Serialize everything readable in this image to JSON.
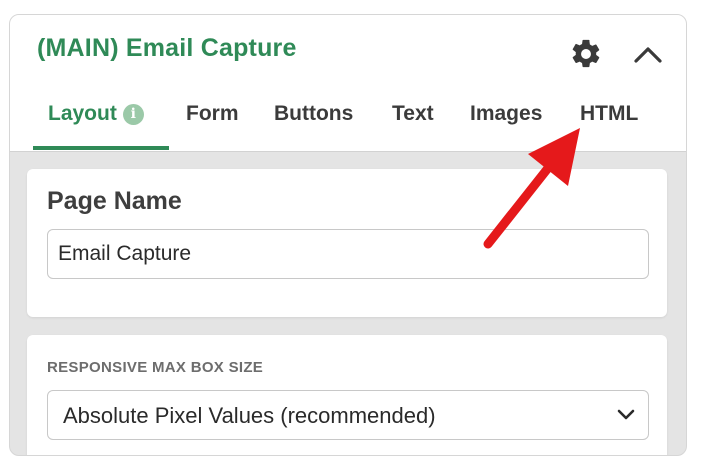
{
  "panel": {
    "title": "(MAIN) Email Capture",
    "settings_icon": "gear-icon",
    "collapse_icon": "chevron-up-icon"
  },
  "tabs": [
    {
      "label": "Layout",
      "active": true,
      "badge": "i"
    },
    {
      "label": "Form",
      "active": false
    },
    {
      "label": "Buttons",
      "active": false
    },
    {
      "label": "Text",
      "active": false
    },
    {
      "label": "Images",
      "active": false
    },
    {
      "label": "HTML",
      "active": false
    }
  ],
  "page_name": {
    "label": "Page Name",
    "value": "Email Capture"
  },
  "responsive": {
    "label": "RESPONSIVE MAX BOX SIZE",
    "selected": "Absolute Pixel Values (recommended)"
  },
  "colors": {
    "accent": "#2f8a57",
    "annotation_arrow": "#e5191b"
  }
}
